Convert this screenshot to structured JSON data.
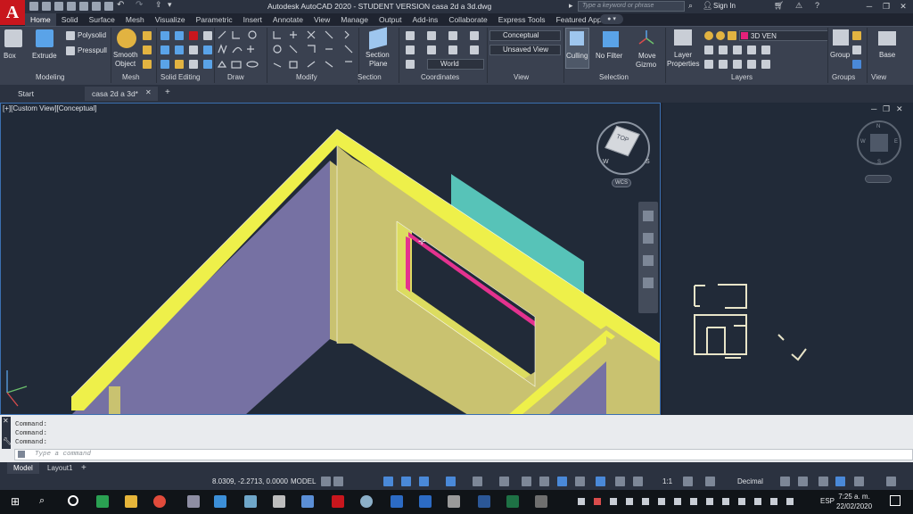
{
  "app": {
    "logo": "A",
    "title": "Autodesk AutoCAD 2020 - STUDENT VERSION    casa 2d a 3d.dwg",
    "search_placeholder": "Type a keyword or phrase",
    "sign_in": "Sign In"
  },
  "ribbon_tabs": [
    "Home",
    "Solid",
    "Surface",
    "Mesh",
    "Visualize",
    "Parametric",
    "Insert",
    "Annotate",
    "View",
    "Manage",
    "Output",
    "Add-ins",
    "Collaborate",
    "Express Tools",
    "Featured Apps"
  ],
  "ribbon": {
    "modeling": {
      "title": "Modeling",
      "box": "Box",
      "extrude": "Extrude",
      "polysolid": "Polysolid",
      "presspull": "Presspull"
    },
    "mesh": {
      "title": "Mesh",
      "smooth_object_1": "Smooth",
      "smooth_object_2": "Object"
    },
    "solid_editing": {
      "title": "Solid Editing"
    },
    "draw": {
      "title": "Draw"
    },
    "modify": {
      "title": "Modify"
    },
    "section": {
      "title": "Section",
      "section_plane_1": "Section",
      "section_plane_2": "Plane"
    },
    "coordinates": {
      "title": "Coordinates",
      "ucs": "World"
    },
    "view": {
      "title": "View",
      "visual_style": "Conceptual",
      "saved_view": "Unsaved View"
    },
    "selection": {
      "title": "Selection",
      "culling": "Culling",
      "no_filter": "No Filter",
      "move_gizmo_1": "Move",
      "move_gizmo_2": "Gizmo"
    },
    "layers": {
      "title": "Layers",
      "layer_properties_1": "Layer",
      "layer_properties_2": "Properties",
      "current_layer": "3D VEN"
    },
    "groups": {
      "title": "Groups",
      "group": "Group"
    },
    "view2": {
      "title": "View",
      "base": "Base"
    }
  },
  "file_tabs": [
    "Start",
    "casa 2d a 3d*"
  ],
  "viewport": {
    "label": "[+][Custom View][Conceptual]",
    "viewcube_label": "WCS",
    "compass": {
      "n": "N",
      "s": "S",
      "e": "E",
      "w": "W"
    },
    "viewcube_face": "TOP"
  },
  "command_history": [
    "Command:",
    "Command:",
    "Command:"
  ],
  "command_placeholder": "Type a command",
  "layout_tabs": [
    "Model",
    "Layout1"
  ],
  "status": {
    "coords": "8.0309, -2.2713, 0.0000",
    "space": "MODEL",
    "scale": "1:1",
    "units": "Decimal"
  },
  "taskbar": {
    "lang": "ESP",
    "time": "7:25 a. m.",
    "date": "22/02/2020"
  }
}
